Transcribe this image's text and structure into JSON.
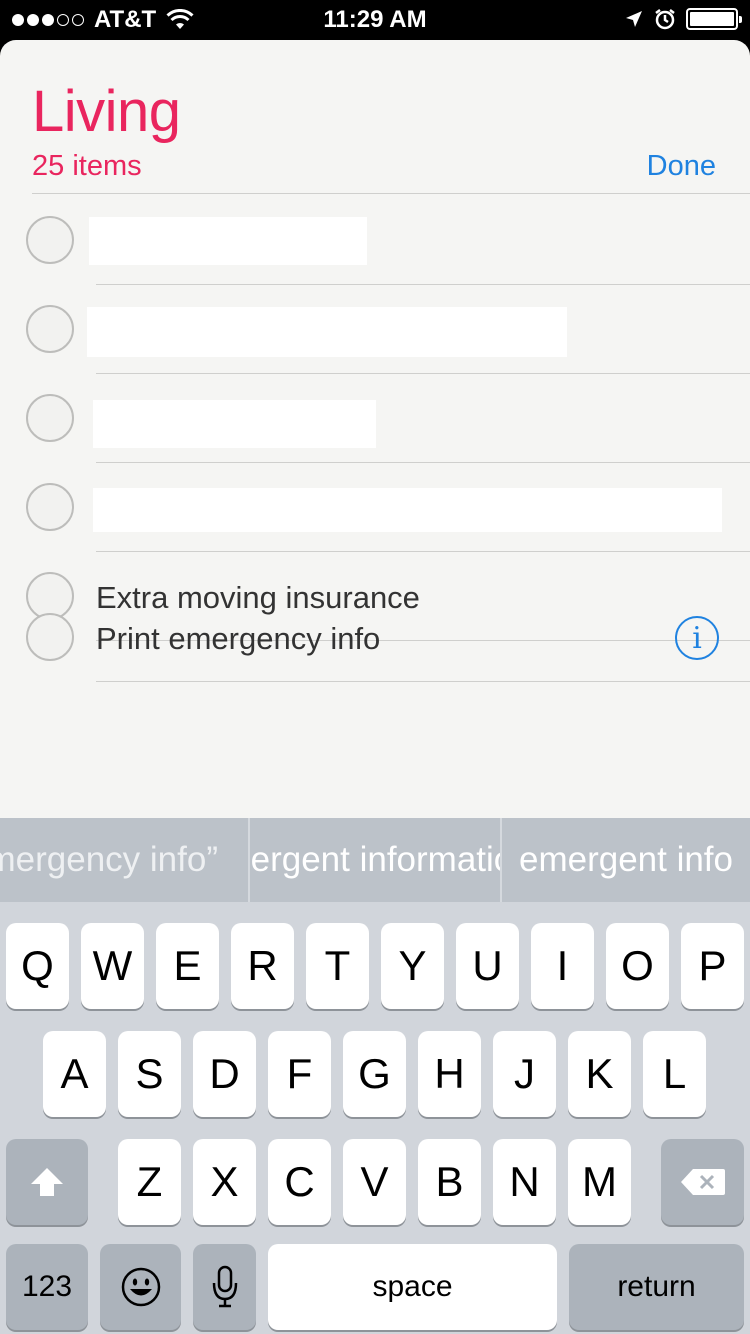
{
  "status_bar": {
    "carrier": "AT&T",
    "time": "11:29 AM",
    "signal_bars": 3,
    "signal_total": 5,
    "battery_level": 1.0
  },
  "list": {
    "title": "Living",
    "item_count": "25 items",
    "done_label": "Done",
    "visible_items": [
      {
        "text": "Extra moving insurance"
      },
      {
        "text": "Print emergency info"
      }
    ]
  },
  "predictions": [
    "“emergency info”",
    "emergent information",
    "emergent info"
  ],
  "keyboard": {
    "row1": [
      "Q",
      "W",
      "E",
      "R",
      "T",
      "Y",
      "U",
      "I",
      "O",
      "P"
    ],
    "row2": [
      "A",
      "S",
      "D",
      "F",
      "G",
      "H",
      "J",
      "K",
      "L"
    ],
    "row3": [
      "Z",
      "X",
      "C",
      "V",
      "B",
      "N",
      "M"
    ],
    "numbers_label": "123",
    "space_label": "space",
    "return_label": "return",
    "icons": {
      "shift": "shift-arrow-icon",
      "delete": "backspace-icon",
      "emoji": "emoji-face-icon",
      "mic": "microphone-icon"
    }
  },
  "colors": {
    "title": "#e9255e",
    "accent": "#1f82e0",
    "keyboard_bg": "#d1d5db",
    "prediction_bg": "#bcc2c9"
  }
}
